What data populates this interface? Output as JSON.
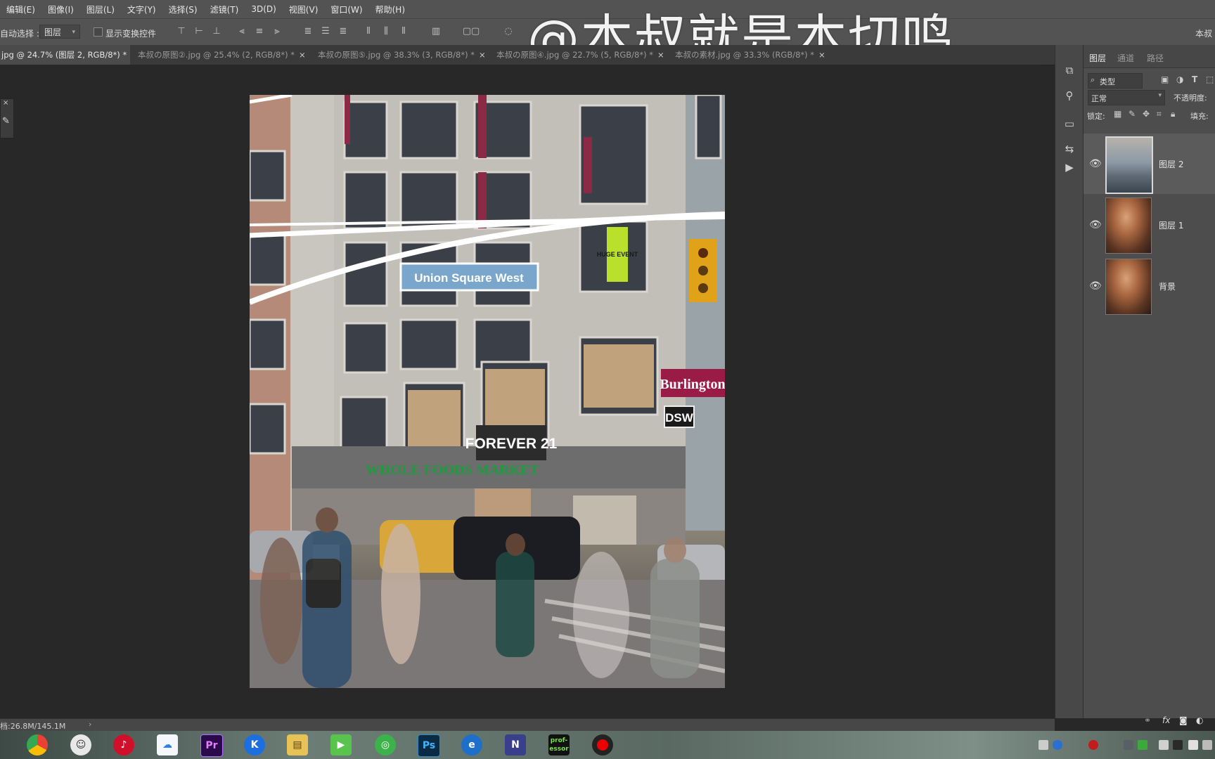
{
  "menubar": {
    "items": [
      "编辑(E)",
      "图像(I)",
      "图层(L)",
      "文字(Y)",
      "选择(S)",
      "滤镜(T)",
      "3D(D)",
      "视图(V)",
      "窗口(W)",
      "帮助(H)"
    ]
  },
  "watermark": "@本叔就是本切鸣",
  "options": {
    "auto_select_label": "自动选择 :",
    "auto_select_value": "图层",
    "show_transform_label": "显示变换控件",
    "right_label": "本叔"
  },
  "tabs": [
    {
      "label": "jpg @ 24.7% (图层 2, RGB/8*) *",
      "active": true
    },
    {
      "label": "本叔の原图②.jpg @ 25.4% (2, RGB/8*) *",
      "active": false
    },
    {
      "label": "本叔の原图⑤.jpg @ 38.3% (3, RGB/8*) *",
      "active": false
    },
    {
      "label": "本叔の原图④.jpg @ 22.7% (5, RGB/8*) *",
      "active": false
    },
    {
      "label": "本叔の素材.jpg @ 33.3% (RGB/8*) *",
      "active": false
    }
  ],
  "photo_signs": {
    "street_sign": "Union Square West",
    "store_1": "Burlington",
    "store_2": "DSW",
    "store_3": "FOREVER 21",
    "store_4": "WHOLE FOODS MARKET",
    "poster": "HUGE EVENT"
  },
  "layers_panel": {
    "tabs": [
      "图层",
      "通道",
      "路径"
    ],
    "filter_label": "类型",
    "blend_mode": "正常",
    "opacity_label": "不透明度:",
    "lock_label": "锁定:",
    "fill_label": "填充:",
    "layers": [
      {
        "name": "图层 2",
        "selected": true
      },
      {
        "name": "图层 1",
        "selected": false
      },
      {
        "name": "背景",
        "selected": false
      }
    ]
  },
  "status": {
    "doc_size": "档:26.8M/145.1M"
  },
  "taskbar": {
    "apps": [
      "chrome",
      "wechat",
      "netease-music",
      "baidu-netdisk",
      "Pr",
      "K",
      "folder",
      "media-player",
      "wps",
      "Ps",
      "ie",
      "N",
      "prof-essor",
      "recorder"
    ],
    "professor_label": "prof-\nessor",
    "pr_label": "Pr",
    "ps_label": "Ps",
    "k_label": "K"
  },
  "colors": {
    "menubar": "#535353",
    "panel": "#4d4d4d",
    "canvas": "#282828",
    "accent_pr": "#2a0a4a",
    "accent_ps": "#0b2a44"
  }
}
